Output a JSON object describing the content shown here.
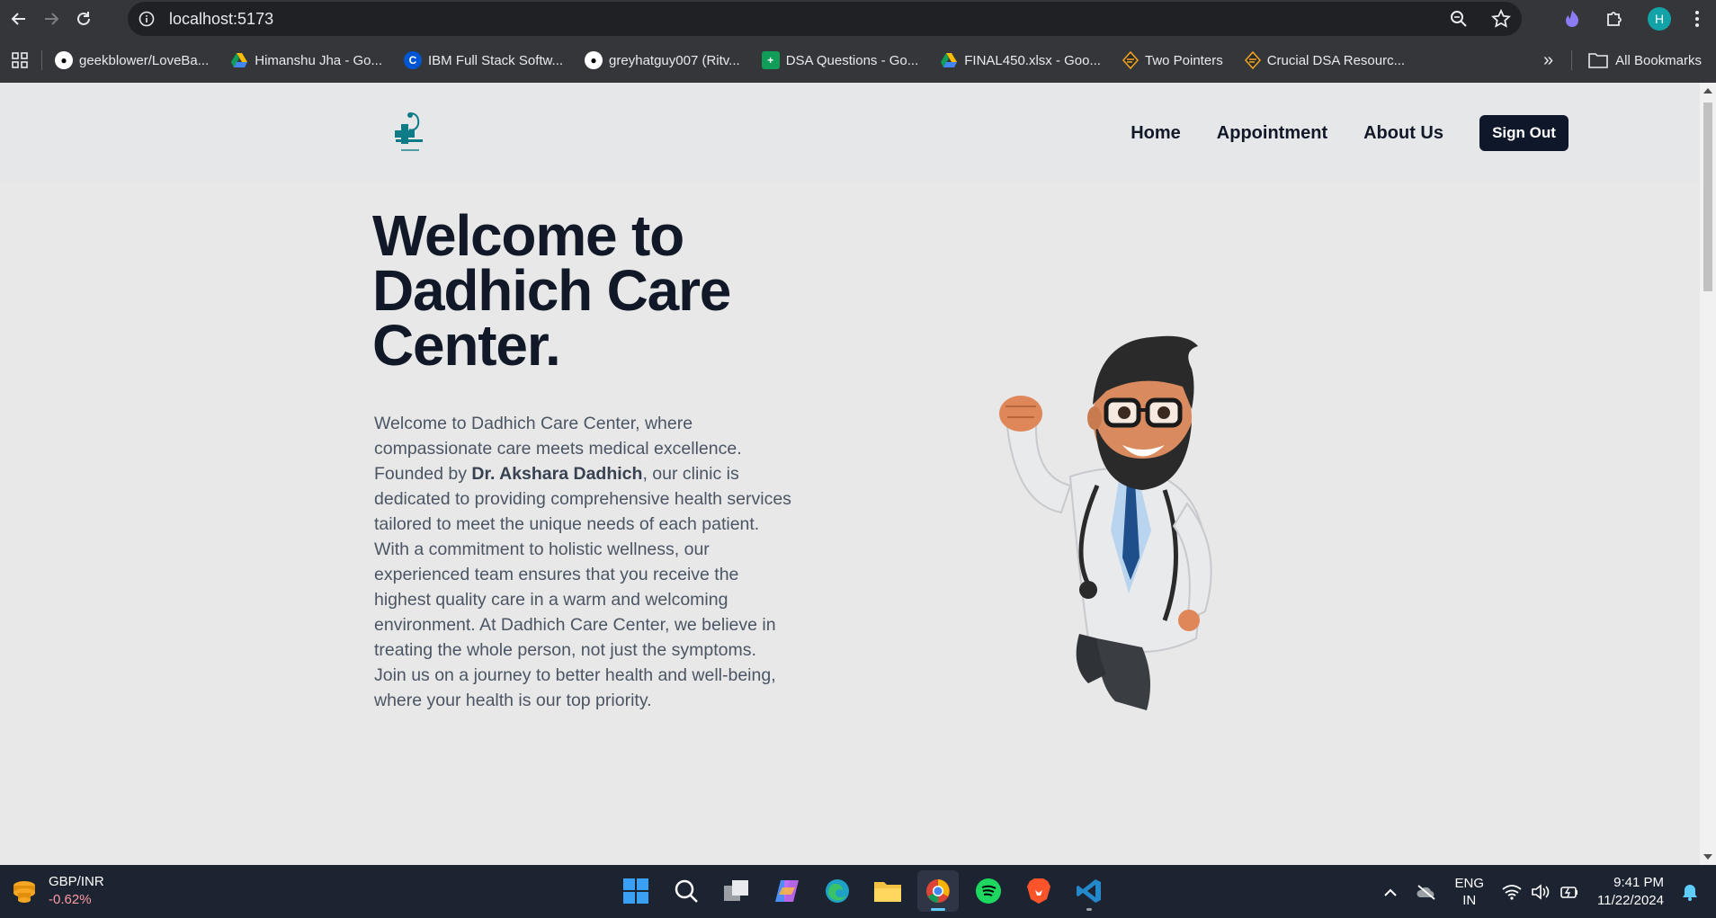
{
  "browser": {
    "url": "localhost:5173",
    "profile_initial": "H",
    "bookmarks": [
      {
        "label": "geekblower/LoveBa...",
        "icon": "github-icon"
      },
      {
        "label": "Himanshu Jha - Go...",
        "icon": "google-drive-icon"
      },
      {
        "label": "IBM Full Stack Softw...",
        "icon": "coursera-icon"
      },
      {
        "label": "greyhatguy007 (Ritv...",
        "icon": "github-icon"
      },
      {
        "label": "DSA Questions - Go...",
        "icon": "google-sheets-icon"
      },
      {
        "label": "FINAL450.xlsx - Goo...",
        "icon": "google-drive-icon"
      },
      {
        "label": "Two Pointers",
        "icon": "codestudio-icon"
      },
      {
        "label": "Crucial DSA Resourc...",
        "icon": "codestudio-icon"
      }
    ],
    "all_bookmarks": "All Bookmarks"
  },
  "site": {
    "nav": {
      "home": "Home",
      "appointment": "Appointment",
      "about": "About Us",
      "signout": "Sign Out"
    },
    "hero": {
      "title": "Welcome to Dadhich Care Center.",
      "text_before": "Welcome to Dadhich Care Center, where compassionate care meets medical excellence. Founded by ",
      "founder": "Dr. Akshara Dadhich",
      "text_after": ", our clinic is dedicated to providing comprehensive health services tailored to meet the unique needs of each patient. With a commitment to holistic wellness, our experienced team ensures that you receive the highest quality care in a warm and welcoming environment. At Dadhich Care Center, we believe in treating the whole person, not just the symptoms. Join us on a journey to better health and well-being, where your health is our top priority."
    }
  },
  "taskbar": {
    "stock_symbol": "GBP/INR",
    "stock_change": "-0.62%",
    "lang_top": "ENG",
    "lang_bottom": "IN",
    "time": "9:41 PM",
    "date": "11/22/2024"
  },
  "colors": {
    "accent": "#0f172a",
    "brand_teal": "#0e7c86",
    "page_bg": "#e8e8e8"
  }
}
